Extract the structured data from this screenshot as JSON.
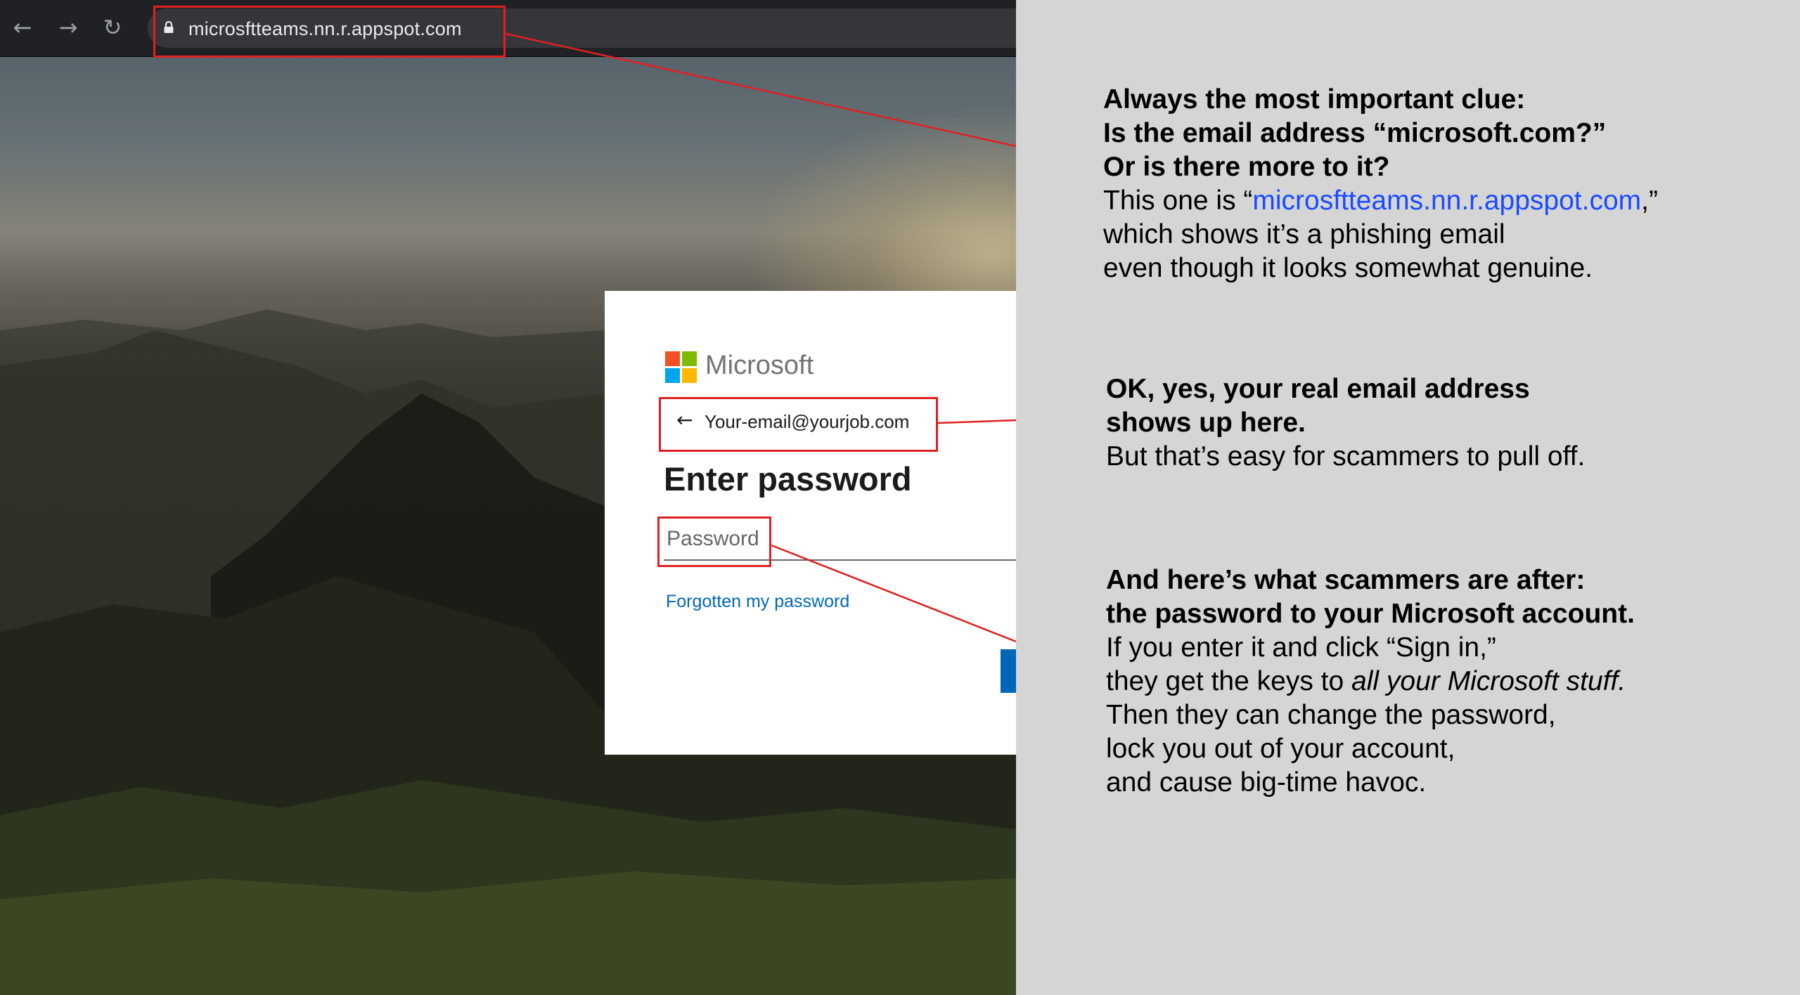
{
  "browser": {
    "url": "microsftteams.nn.r.appspot.com",
    "back_icon": "arrow-left",
    "forward_icon": "arrow-right",
    "reload_icon": "reload",
    "lock_icon": "lock"
  },
  "login_card": {
    "brand": "Microsoft",
    "email": "Your-email@yourjob.com",
    "heading": "Enter password",
    "password_placeholder": "Password",
    "forgot_link": "Forgotten my password"
  },
  "annotations": {
    "block1": {
      "line1": "Always the most important clue:",
      "line2": "Is the email address “microsoft.com?”",
      "line3": "Or is there more to it?",
      "line4_prefix": "This one is “",
      "line4_link": "microsftteams.nn.r.appspot.com",
      "line4_suffix": ",”",
      "line5": "which shows it’s a phishing email",
      "line6": "even though it looks somewhat genuine."
    },
    "block2": {
      "line1": "OK, yes, your real email address",
      "line2": "shows up here.",
      "line3": "But that’s easy for scammers to pull off."
    },
    "block3": {
      "line1": "And here’s what scammers are after:",
      "line2": "the password to your Microsoft account.",
      "line3": "If you enter it and click “Sign in,”",
      "line4_prefix": "they get the keys to ",
      "line4_italic": "all your Microsoft stuff.",
      "line5": "Then they can change the password,",
      "line6": "lock you out of your account,",
      "line7": "and cause big-time havoc."
    }
  },
  "colors": {
    "highlight_red": "#e02020",
    "link_blue": "#1a4bff",
    "ms_blue": "#0067b8",
    "ms_logo": [
      "#f25022",
      "#7fba00",
      "#00a4ef",
      "#ffb900"
    ]
  }
}
